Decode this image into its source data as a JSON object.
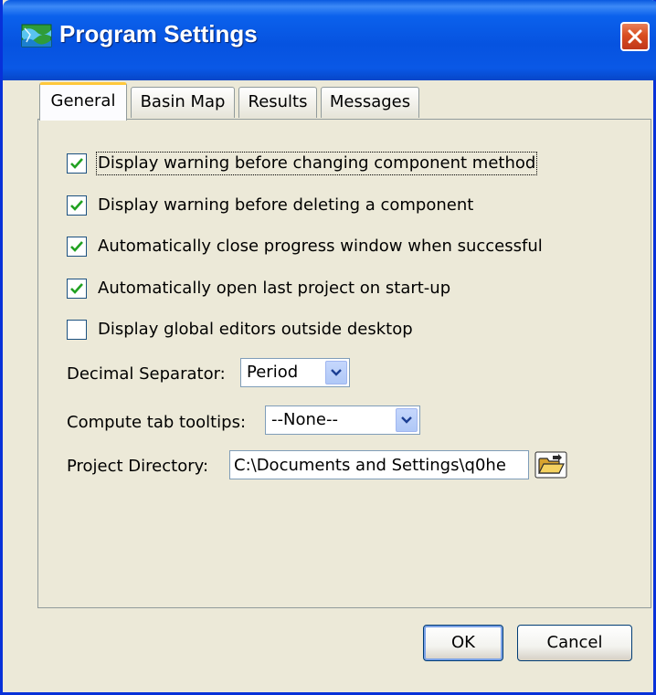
{
  "window": {
    "title": "Program Settings",
    "icon": "basin-map-icon"
  },
  "titlebar": {
    "close_icon": "close-icon"
  },
  "tabs": [
    {
      "label": "General",
      "active": true
    },
    {
      "label": "Basin Map",
      "active": false
    },
    {
      "label": "Results",
      "active": false
    },
    {
      "label": "Messages",
      "active": false
    }
  ],
  "general": {
    "checkboxes": [
      {
        "label": "Display warning before changing component method",
        "checked": true
      },
      {
        "label": "Display warning before deleting a component",
        "checked": true
      },
      {
        "label": "Automatically close progress window when successful",
        "checked": true
      },
      {
        "label": "Automatically open last project on start-up",
        "checked": true
      },
      {
        "label": "Display global editors outside desktop",
        "checked": false
      }
    ],
    "decimal_separator": {
      "label": "Decimal Separator:",
      "value": "Period"
    },
    "compute_tab_tooltips": {
      "label": "Compute tab tooltips:",
      "value": "--None--"
    },
    "project_directory": {
      "label": "Project Directory:",
      "value": "C:\\Documents and Settings\\q0he",
      "browse_icon": "folder-open-icon"
    }
  },
  "buttons": {
    "ok": "OK",
    "cancel": "Cancel"
  },
  "colors": {
    "titlebar": "#0653e0",
    "accent_tab": "#ffc83c",
    "close": "#d94d1f",
    "background": "#ece9d8"
  }
}
